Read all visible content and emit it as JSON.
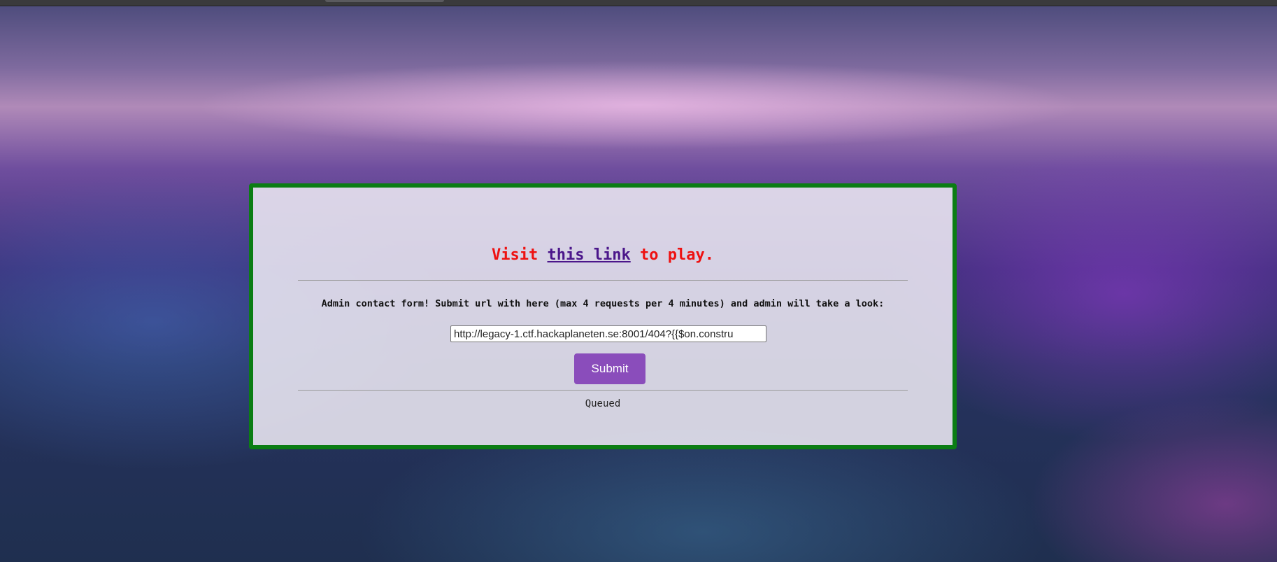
{
  "headline": {
    "prefix": "Visit ",
    "link_text": "this link",
    "suffix": " to play."
  },
  "contact_form": {
    "label": "Admin contact form! Submit url with here (max 4 requests per 4 minutes) and admin will take a look:",
    "url_value": "http://legacy-1.ctf.hackaplaneten.se:8001/404?{{$on.constru",
    "submit_label": "Submit"
  },
  "status": {
    "text": "Queued"
  },
  "colors": {
    "panel_border": "#0b7d14",
    "headline": "#ee1111",
    "link": "#4b168a",
    "button": "#8a4dbb"
  }
}
